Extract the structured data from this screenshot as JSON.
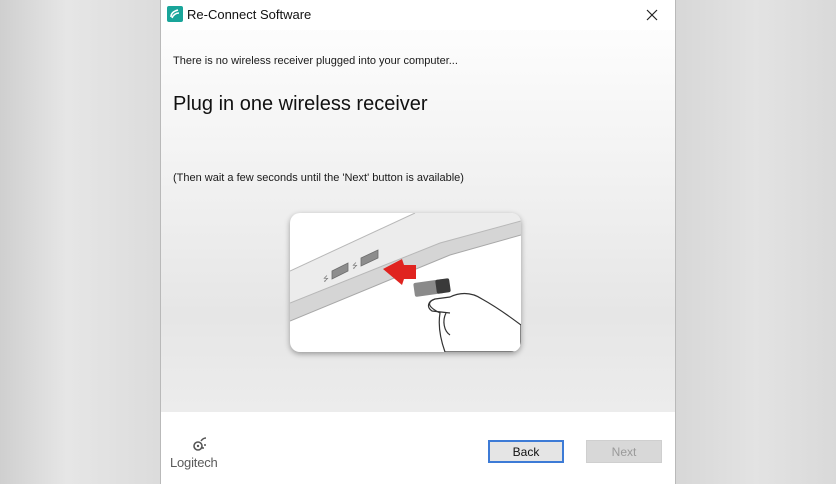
{
  "window": {
    "title": "Re-Connect Software",
    "accent": "#19a59a"
  },
  "content": {
    "status_message": "There is no wireless receiver plugged into your computer...",
    "heading": "Plug in one wireless receiver",
    "hint": "(Then wait a few seconds until the 'Next' button is available)",
    "illustration": "usb-receiver-plug-in-illustration"
  },
  "footer": {
    "brand": "Logitech",
    "back_label": "Back",
    "next_label": "Next",
    "next_enabled": false
  },
  "colors": {
    "focus_border": "#3d7bd6",
    "arrow": "#e0231f"
  }
}
